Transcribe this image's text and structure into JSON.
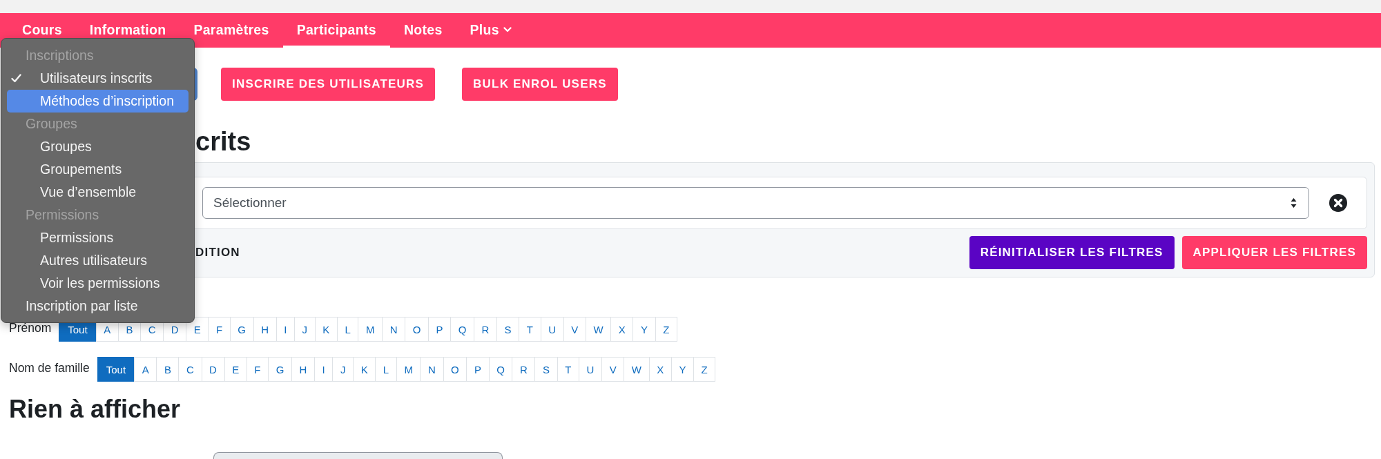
{
  "nav": {
    "tabs": [
      {
        "label": "Cours",
        "selected": false,
        "kind": "link"
      },
      {
        "label": "Information",
        "selected": false,
        "kind": "link"
      },
      {
        "label": "Paramètres",
        "selected": false,
        "kind": "link"
      },
      {
        "label": "Participants",
        "selected": true,
        "kind": "link"
      },
      {
        "label": "Notes",
        "selected": false,
        "kind": "link"
      },
      {
        "label": "Plus",
        "selected": false,
        "kind": "menu"
      }
    ]
  },
  "dropdown_menu": {
    "items": [
      {
        "kind": "group",
        "label": "Inscriptions",
        "children": [
          {
            "kind": "option",
            "label": "Utilisateurs inscrits",
            "checked": true,
            "selected": false
          },
          {
            "kind": "option",
            "label": "Méthodes d’inscription",
            "checked": false,
            "selected": true
          }
        ]
      },
      {
        "kind": "group",
        "label": "Groupes",
        "children": [
          {
            "kind": "option",
            "label": "Groupes",
            "checked": false,
            "selected": false
          },
          {
            "kind": "option",
            "label": "Groupements",
            "checked": false,
            "selected": false
          },
          {
            "kind": "option",
            "label": "Vue d’ensemble",
            "checked": false,
            "selected": false
          }
        ]
      },
      {
        "kind": "group",
        "label": "Permissions",
        "children": [
          {
            "kind": "option",
            "label": "Permissions",
            "checked": false,
            "selected": false
          },
          {
            "kind": "option",
            "label": "Autres utilisateurs",
            "checked": false,
            "selected": false
          },
          {
            "kind": "option",
            "label": "Voir les permissions",
            "checked": false,
            "selected": false
          }
        ]
      },
      {
        "kind": "option",
        "label": "Inscription par liste",
        "checked": false,
        "selected": false
      }
    ]
  },
  "toolbar": {
    "buttons": [
      {
        "label": "INSCRIRE DES UTILISATEURS"
      },
      {
        "label": "BULK ENROL USERS"
      }
    ]
  },
  "heading": "crits",
  "filters": {
    "conditions": [
      {
        "value": "Sélectionner"
      }
    ],
    "add_condition": "DITION",
    "buttons": [
      {
        "label": "RÉINITIALISER LES FILTRES",
        "kind": "reset"
      },
      {
        "label": "APPLIQUER LES FILTRES",
        "kind": "apply"
      }
    ]
  },
  "initials": [
    {
      "label": "Prénom",
      "letters": [
        {
          "label": "Tout",
          "selected": true
        },
        {
          "label": "A",
          "selected": false
        },
        {
          "label": "B",
          "selected": false
        },
        {
          "label": "C",
          "selected": false
        },
        {
          "label": "D",
          "selected": false
        },
        {
          "label": "E",
          "selected": false
        },
        {
          "label": "F",
          "selected": false
        },
        {
          "label": "G",
          "selected": false
        },
        {
          "label": "H",
          "selected": false
        },
        {
          "label": "I",
          "selected": false
        },
        {
          "label": "J",
          "selected": false
        },
        {
          "label": "K",
          "selected": false
        },
        {
          "label": "L",
          "selected": false
        },
        {
          "label": "M",
          "selected": false
        },
        {
          "label": "N",
          "selected": false
        },
        {
          "label": "O",
          "selected": false
        },
        {
          "label": "P",
          "selected": false
        },
        {
          "label": "Q",
          "selected": false
        },
        {
          "label": "R",
          "selected": false
        },
        {
          "label": "S",
          "selected": false
        },
        {
          "label": "T",
          "selected": false
        },
        {
          "label": "U",
          "selected": false
        },
        {
          "label": "V",
          "selected": false
        },
        {
          "label": "W",
          "selected": false
        },
        {
          "label": "X",
          "selected": false
        },
        {
          "label": "Y",
          "selected": false
        },
        {
          "label": "Z",
          "selected": false
        }
      ]
    },
    {
      "label": "Nom de famille",
      "letters": [
        {
          "label": "Tout",
          "selected": true
        },
        {
          "label": "A",
          "selected": false
        },
        {
          "label": "B",
          "selected": false
        },
        {
          "label": "C",
          "selected": false
        },
        {
          "label": "D",
          "selected": false
        },
        {
          "label": "E",
          "selected": false
        },
        {
          "label": "F",
          "selected": false
        },
        {
          "label": "G",
          "selected": false
        },
        {
          "label": "H",
          "selected": false
        },
        {
          "label": "I",
          "selected": false
        },
        {
          "label": "J",
          "selected": false
        },
        {
          "label": "K",
          "selected": false
        },
        {
          "label": "L",
          "selected": false
        },
        {
          "label": "M",
          "selected": false
        },
        {
          "label": "N",
          "selected": false
        },
        {
          "label": "O",
          "selected": false
        },
        {
          "label": "P",
          "selected": false
        },
        {
          "label": "Q",
          "selected": false
        },
        {
          "label": "R",
          "selected": false
        },
        {
          "label": "S",
          "selected": false
        },
        {
          "label": "T",
          "selected": false
        },
        {
          "label": "U",
          "selected": false
        },
        {
          "label": "V",
          "selected": false
        },
        {
          "label": "W",
          "selected": false
        },
        {
          "label": "X",
          "selected": false
        },
        {
          "label": "Y",
          "selected": false
        },
        {
          "label": "Z",
          "selected": false
        }
      ]
    }
  ],
  "empty_message": "Rien à afficher"
}
